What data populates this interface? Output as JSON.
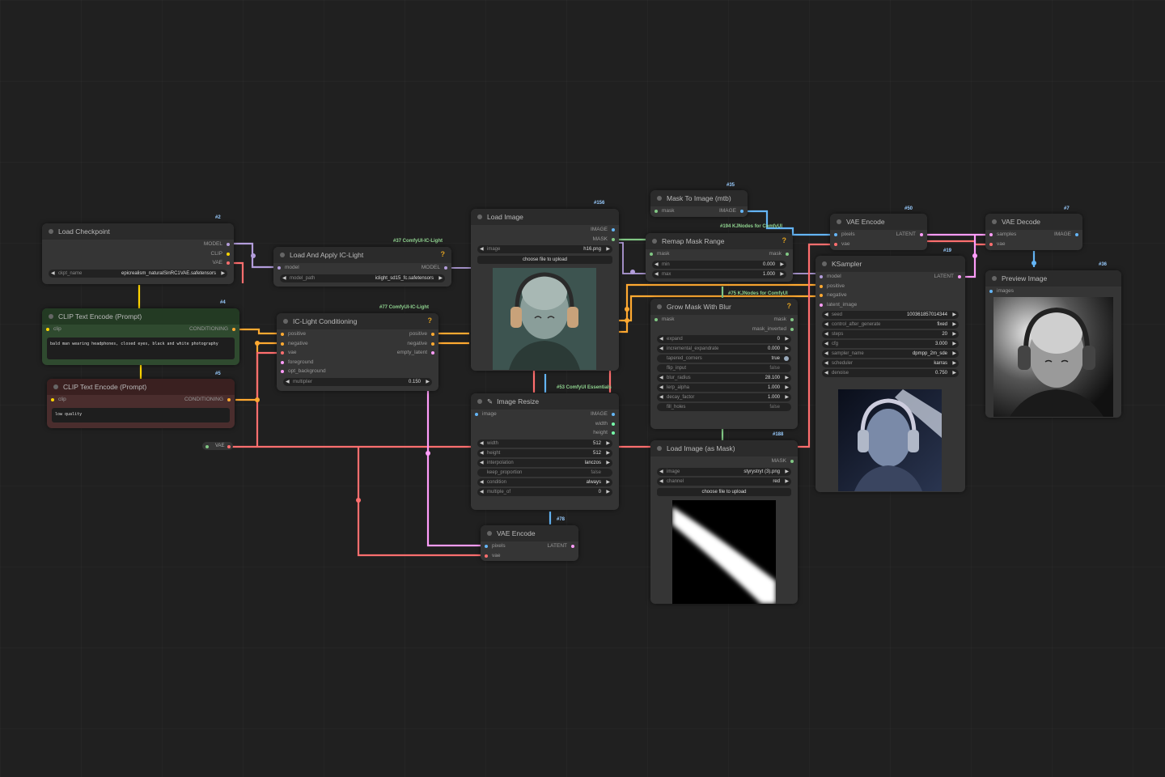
{
  "badges": {
    "n2": "#2",
    "n4": "#4",
    "n5": "#5",
    "n37": "#37 ComfyUI-IC-Light",
    "n77": "#77 ComfyUI-IC-Light",
    "n156": "#156",
    "n35": "#35",
    "n194": "#194 KJNodes for ComfyUI",
    "n75": "#75 KJNodes for ComfyUI",
    "n53": "#53 ComfyUI Essentials",
    "n188": "#188",
    "n78": "#78",
    "n50": "#50",
    "n19": "#19",
    "n7": "#7",
    "n36": "#36"
  },
  "load_checkpoint": {
    "title": "Load Checkpoint",
    "out_model": "MODEL",
    "out_clip": "CLIP",
    "out_vae": "VAE",
    "w_ckpt_key": "ckpt_name",
    "w_ckpt_val": "epicrealism_naturalSinRC1VAE.safetensors"
  },
  "clip_pos": {
    "title": "CLIP Text Encode (Prompt)",
    "in_clip": "clip",
    "out": "CONDITIONING",
    "text": "bald man wearing headphones, closed eyes, black and white photography"
  },
  "clip_neg": {
    "title": "CLIP Text Encode (Prompt)",
    "in_clip": "clip",
    "out": "CONDITIONING",
    "text": "low quality"
  },
  "vae_reroute": {
    "label": "VAE"
  },
  "load_iclight": {
    "title": "Load And Apply IC-Light",
    "in_model": "model",
    "out_model": "MODEL",
    "w_key": "model_path",
    "w_val": "iclight_sd15_fc.safetensors"
  },
  "iclight_cond": {
    "title": "IC-Light Conditioning",
    "in": [
      "positive",
      "negative",
      "vae",
      "foreground",
      "opt_background"
    ],
    "out": [
      "positive",
      "negative",
      "empty_latent"
    ],
    "w_key": "multiplier",
    "w_val": "0.150"
  },
  "load_image": {
    "title": "Load Image",
    "out_image": "IMAGE",
    "out_mask": "MASK",
    "w_key": "image",
    "w_val": "h16.png",
    "upload": "choose file to upload"
  },
  "image_resize": {
    "title": "Image Resize",
    "in_image": "image",
    "out_image": "IMAGE",
    "out_width": "width",
    "out_height": "height",
    "widgets": [
      {
        "k": "width",
        "v": "512"
      },
      {
        "k": "height",
        "v": "512"
      },
      {
        "k": "interpolation",
        "v": "lanczos"
      },
      {
        "k": "keep_proportion",
        "v": "false"
      },
      {
        "k": "condition",
        "v": "always"
      },
      {
        "k": "multiple_of",
        "v": "0"
      }
    ]
  },
  "vae_encode_1": {
    "title": "VAE Encode",
    "in_pixels": "pixels",
    "in_vae": "vae",
    "out": "LATENT"
  },
  "mask_to_image": {
    "title": "Mask To Image (mtb)",
    "in_mask": "mask",
    "out": "IMAGE"
  },
  "remap_mask": {
    "title": "Remap Mask Range",
    "in_mask": "mask",
    "out_mask": "mask",
    "widgets": [
      {
        "k": "min",
        "v": "0.000"
      },
      {
        "k": "max",
        "v": "1.000"
      }
    ]
  },
  "grow_mask": {
    "title": "Grow Mask With Blur",
    "in_mask": "mask",
    "out_mask": "mask",
    "out_inv": "mask_inverted",
    "widgets": [
      {
        "k": "expand",
        "v": "0"
      },
      {
        "k": "incremental_expandrate",
        "v": "0.000"
      },
      {
        "k": "tapered_corners",
        "v": "true"
      },
      {
        "k": "flip_input",
        "v": "false"
      },
      {
        "k": "blur_radius",
        "v": "28.100"
      },
      {
        "k": "lerp_alpha",
        "v": "1.000"
      },
      {
        "k": "decay_factor",
        "v": "1.000"
      },
      {
        "k": "fill_holes",
        "v": "false"
      }
    ]
  },
  "load_mask": {
    "title": "Load Image (as Mask)",
    "out": "MASK",
    "widgets": [
      {
        "k": "image",
        "v": "styrystryt (3).png"
      },
      {
        "k": "channel",
        "v": "red"
      }
    ],
    "upload": "choose file to upload"
  },
  "vae_encode_2": {
    "title": "VAE Encode",
    "in_pixels": "pixels",
    "in_vae": "vae",
    "out": "LATENT"
  },
  "ksampler": {
    "title": "KSampler",
    "in": [
      "model",
      "positive",
      "negative",
      "latent_image"
    ],
    "out": "LATENT",
    "widgets": [
      {
        "k": "seed",
        "v": "100361857014344"
      },
      {
        "k": "control_after_generate",
        "v": "fixed"
      },
      {
        "k": "steps",
        "v": "20"
      },
      {
        "k": "cfg",
        "v": "3.000"
      },
      {
        "k": "sampler_name",
        "v": "dpmpp_2m_sde"
      },
      {
        "k": "scheduler",
        "v": "karras"
      },
      {
        "k": "denoise",
        "v": "0.750"
      }
    ]
  },
  "vae_decode": {
    "title": "VAE Decode",
    "in_samples": "samples",
    "in_vae": "vae",
    "out": "IMAGE"
  },
  "preview": {
    "title": "Preview Image",
    "in_images": "images"
  },
  "colors": {
    "model": "#b39ddb",
    "clip": "#ffd500",
    "vae": "#ff6e6e",
    "cond": "#ffa931",
    "latent": "#ff9cf9",
    "image": "#64b5f6",
    "mask": "#81c784"
  }
}
